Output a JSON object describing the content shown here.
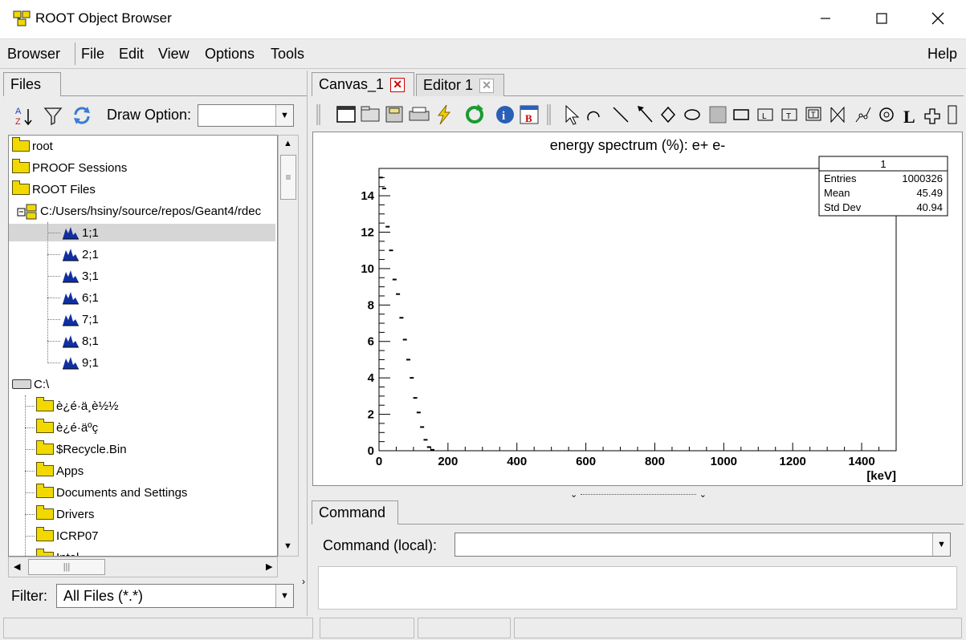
{
  "window": {
    "title": "ROOT Object Browser"
  },
  "menu": {
    "browser": "Browser",
    "file": "File",
    "edit": "Edit",
    "view": "View",
    "options": "Options",
    "tools": "Tools",
    "help": "Help"
  },
  "left_panel": {
    "tab": "Files",
    "draw_option_label": "Draw Option:",
    "draw_option_value": "",
    "filter_label": "Filter:",
    "filter_value": "All Files (*.*)"
  },
  "tree": {
    "items": [
      {
        "label": "root",
        "icon": "folder-icon"
      },
      {
        "label": "PROOF Sessions",
        "icon": "folder-icon"
      },
      {
        "label": "ROOT Files",
        "icon": "folder-open-icon"
      },
      {
        "label": "C:/Users/hsiny/source/repos/Geant4/rdec",
        "icon": "root-file-icon"
      },
      {
        "label": "1;1",
        "icon": "histogram-icon"
      },
      {
        "label": "2;1",
        "icon": "histogram-icon"
      },
      {
        "label": "3;1",
        "icon": "histogram-icon"
      },
      {
        "label": "6;1",
        "icon": "histogram-icon"
      },
      {
        "label": "7;1",
        "icon": "histogram-icon"
      },
      {
        "label": "8;1",
        "icon": "histogram-icon"
      },
      {
        "label": "9;1",
        "icon": "histogram-icon"
      },
      {
        "label": "C:\\",
        "icon": "drive-icon"
      },
      {
        "label": "è¿é·ä¸è½½",
        "icon": "folder-icon"
      },
      {
        "label": "è¿é·äºç",
        "icon": "folder-icon"
      },
      {
        "label": "$Recycle.Bin",
        "icon": "folder-icon"
      },
      {
        "label": "Apps",
        "icon": "folder-icon"
      },
      {
        "label": "Documents and Settings",
        "icon": "folder-icon"
      },
      {
        "label": "Drivers",
        "icon": "folder-icon"
      },
      {
        "label": "ICRP07",
        "icon": "folder-icon"
      },
      {
        "label": "Intel",
        "icon": "folder-icon"
      }
    ]
  },
  "tabs": {
    "canvas": "Canvas_1",
    "editor": "Editor 1"
  },
  "stats": {
    "title": "1",
    "rows": [
      {
        "k": "Entries",
        "v": "1000326"
      },
      {
        "k": "Mean",
        "v": "45.49"
      },
      {
        "k": "Std Dev",
        "v": "40.94"
      }
    ]
  },
  "chart_data": {
    "type": "scatter",
    "title": "energy spectrum (%): e+ e-",
    "xlabel": "[keV]",
    "ylabel": "",
    "xlim": [
      0,
      1500
    ],
    "ylim": [
      0,
      15.5
    ],
    "xticks": [
      0,
      200,
      400,
      600,
      800,
      1000,
      1200,
      1400
    ],
    "yticks": [
      0,
      2,
      4,
      6,
      8,
      10,
      12,
      14
    ],
    "series": [
      {
        "x": [
          5,
          15,
          25,
          35,
          45,
          55,
          65,
          75,
          85,
          95,
          105,
          115,
          125,
          135,
          145,
          155
        ],
        "values": [
          15.0,
          14.4,
          12.3,
          11.0,
          9.4,
          8.6,
          7.3,
          6.1,
          5.0,
          4.0,
          2.9,
          2.1,
          1.3,
          0.6,
          0.2,
          0.05
        ]
      }
    ]
  },
  "command": {
    "tab": "Command",
    "label": "Command (local):",
    "value": ""
  }
}
